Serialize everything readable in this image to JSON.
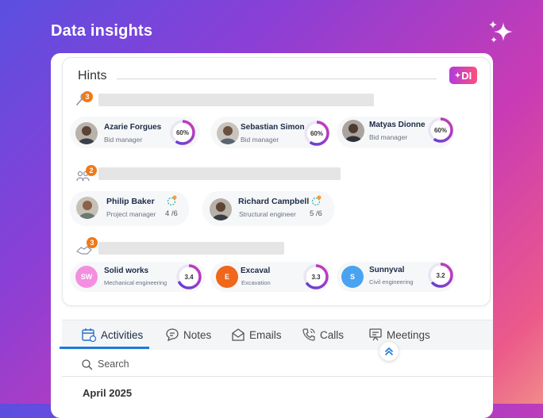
{
  "header": {
    "title": "Data insights",
    "sparkle_icon": "sparkle-icon"
  },
  "hints": {
    "title": "Hints",
    "badge": "DI",
    "sections": [
      {
        "icon": "person-search-icon",
        "count": "3",
        "people": [
          {
            "name": "Azarie Forgues",
            "role": "Bid manager",
            "percent": "60%",
            "fraction": 0.6
          },
          {
            "name": "Sebastian Simon",
            "role": "Bid manager",
            "percent": "60%",
            "fraction": 0.6
          },
          {
            "name": "Matyas Dionne",
            "role": "Bid manager",
            "percent": "60%",
            "fraction": 0.6
          }
        ]
      },
      {
        "icon": "team-icon",
        "count": "2",
        "people": [
          {
            "name": "Philip Baker",
            "role": "Project manager",
            "ratio": "4 /6"
          },
          {
            "name": "Richard Campbell",
            "role": "Structural engineer",
            "ratio": "5 /6"
          }
        ]
      },
      {
        "icon": "handshake-icon",
        "count": "3",
        "companies": [
          {
            "initials": "SW",
            "name": "Solid works",
            "field": "Mechanical engineering",
            "score": "3.4",
            "fraction": 0.68,
            "color": "#f48fe0"
          },
          {
            "initials": "E",
            "name": "Excaval",
            "field": "Excavation",
            "score": "3.3",
            "fraction": 0.66,
            "color": "#f0661a"
          },
          {
            "initials": "S",
            "name": "Sunnyval",
            "field": "Civil engineering",
            "score": "3.2",
            "fraction": 0.64,
            "color": "#4aa3f0"
          }
        ]
      }
    ]
  },
  "tabs": [
    {
      "label": "Activities",
      "icon": "calendar-icon",
      "active": true
    },
    {
      "label": "Notes",
      "icon": "chat-bubble-icon",
      "active": false
    },
    {
      "label": "Emails",
      "icon": "envelope-icon",
      "active": false
    },
    {
      "label": "Calls",
      "icon": "phone-icon",
      "active": false
    },
    {
      "label": "Meetings",
      "icon": "presentation-icon",
      "active": false
    }
  ],
  "search": {
    "placeholder": "Search"
  },
  "timeline": {
    "month": "April 2025"
  },
  "colors": {
    "accent": "#1d7ad8",
    "ring_start": "#5a3fd8",
    "ring_end": "#d13bb8",
    "count_badge": "#f07a18"
  }
}
